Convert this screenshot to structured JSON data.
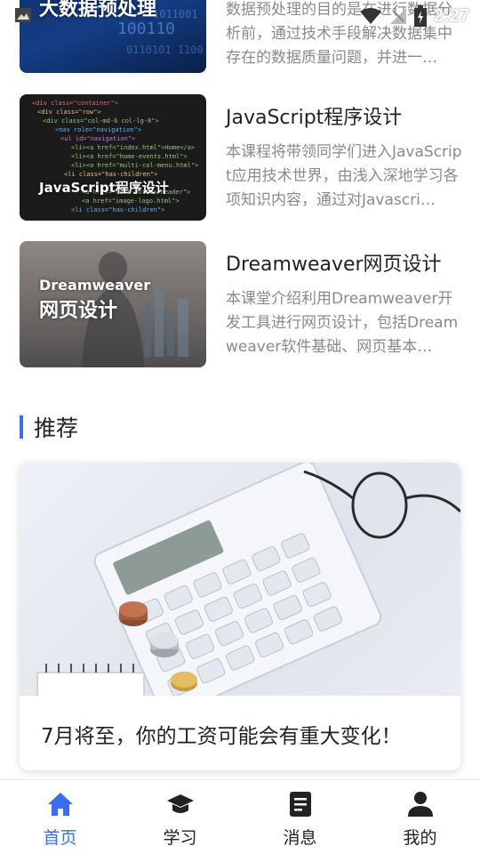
{
  "status_bar": {
    "time": "2:27"
  },
  "courses": [
    {
      "thumb_text": "大数据预处理",
      "title": "",
      "desc": "数据预处理的目的是在进行数据分析前，通过技术手段解决数据集中存在的数据质量问题，并进一…"
    },
    {
      "thumb_text": "JavaScript程序设计",
      "title": "JavaScript程序设计",
      "desc": "本课程将带领同学们进入JavaScript应用技术世界，由浅入深地学习各项知识内容，通过对Javascri…"
    },
    {
      "thumb_text_line1": "Dreamweaver",
      "thumb_text_line2": "网页设计",
      "title": "Dreamweaver网页设计",
      "desc": "本课堂介绍利用Dreamweaver开发工具进行网页设计，包括Dreamweaver软件基础、网页基本…"
    }
  ],
  "recommend": {
    "section_title": "推荐",
    "card_title": "7月将至，你的工资可能会有重大变化！"
  },
  "tabbar": {
    "items": [
      {
        "label": "首页",
        "icon": "home-icon",
        "active": true
      },
      {
        "label": "学习",
        "icon": "graduation-cap-icon",
        "active": false
      },
      {
        "label": "消息",
        "icon": "message-icon",
        "active": false
      },
      {
        "label": "我的",
        "icon": "person-icon",
        "active": false
      }
    ]
  },
  "colors": {
    "accent": "#3a6cf4",
    "muted_text": "#8a8a8a"
  }
}
